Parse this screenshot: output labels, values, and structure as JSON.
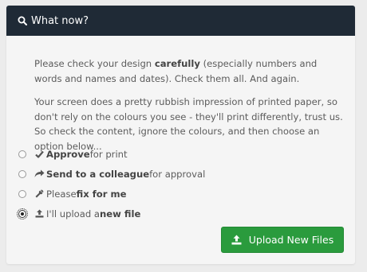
{
  "header": {
    "title": "What now?",
    "icon": "search-icon"
  },
  "intro": {
    "p1_prefix": "Please check your design ",
    "p1_bold": "carefully",
    "p1_suffix": " (especially numbers and words and names and dates). Check them all. And again.",
    "p2": "Your screen does a pretty rubbish impression of printed paper, so don't rely on the colours you see - they'll print differently, trust us. So check the content, ignore the colours, and then choose an option below..."
  },
  "options": [
    {
      "icon": "check-icon",
      "pre": "",
      "bold": "Approve",
      "post": " for print",
      "checked": false
    },
    {
      "icon": "share-arrow-icon",
      "pre": "",
      "bold": "Send to a colleague",
      "post": " for approval",
      "checked": false
    },
    {
      "icon": "wrench-icon",
      "pre": "Please ",
      "bold": "fix for me",
      "post": "",
      "checked": false
    },
    {
      "icon": "upload-icon",
      "pre": "I'll upload a ",
      "bold": "new file",
      "post": "",
      "checked": true
    }
  ],
  "upload_button": {
    "label": "Upload New Files",
    "icon": "upload-icon"
  },
  "colors": {
    "header_bg": "#1f2a36",
    "button_bg": "#2a9b3d",
    "panel_bg": "#f5f5f5"
  }
}
